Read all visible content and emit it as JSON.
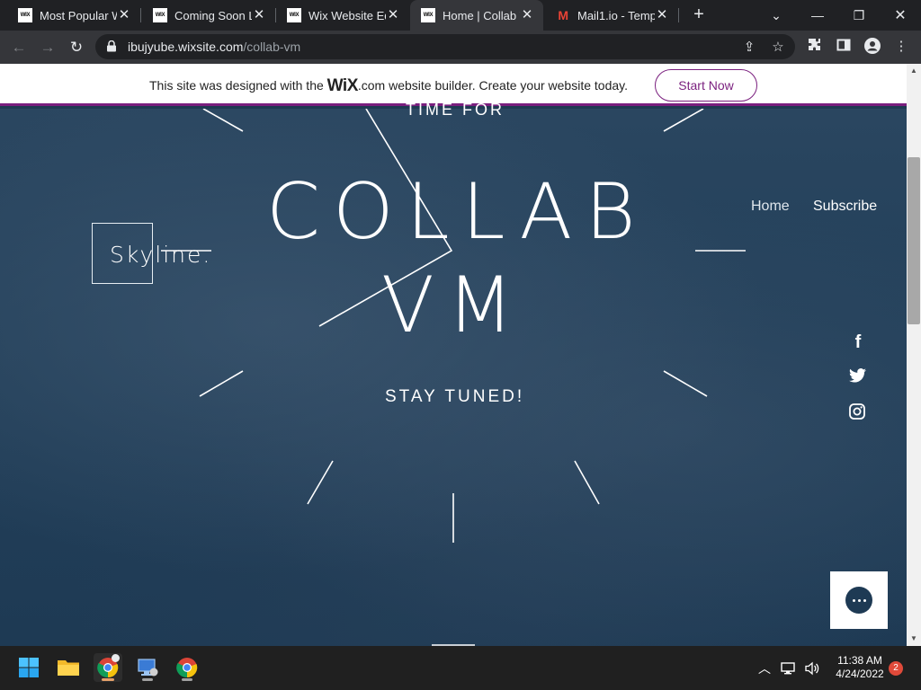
{
  "browser": {
    "tabs": [
      {
        "title": "Most Popular W",
        "favicon": "wix-favicon",
        "active": false
      },
      {
        "title": "Coming Soon La",
        "favicon": "wix-favicon",
        "active": false
      },
      {
        "title": "Wix Website Ed",
        "favicon": "wix-favicon",
        "active": false
      },
      {
        "title": "Home | Collab V",
        "favicon": "wix-favicon",
        "active": true
      },
      {
        "title": "Mail1.io - Temp",
        "favicon": "gmail-favicon",
        "active": false
      }
    ],
    "favicon_text": "WIX",
    "gmail_glyph": "M",
    "url_host": "ibujyube.wixsite.com",
    "url_path": "/collab-vm"
  },
  "wix_banner": {
    "text_before": "This site was designed with the ",
    "logo": "WiX",
    "text_after": ".com website builder. Create your website today.",
    "cta": "Start Now",
    "accent": "#7a1f7e"
  },
  "site": {
    "logo": "Skyline.",
    "nav": [
      "Home",
      "Subscribe"
    ],
    "hero_top": "TIME FOR",
    "hero_title_line1": "COLLAB",
    "hero_title_line2": "VM",
    "hero_tagline": "STAY TUNED!",
    "social": [
      "facebook-icon",
      "twitter-icon",
      "instagram-icon"
    ],
    "facebook_glyph": "f",
    "background_color": "#1f3a52"
  },
  "taskbar": {
    "apps": [
      "windows-start-icon",
      "file-explorer-icon",
      "chrome-icon",
      "remote-desktop-icon",
      "chrome-icon"
    ],
    "time": "11:38 AM",
    "date": "4/24/2022",
    "notifications": "2"
  }
}
